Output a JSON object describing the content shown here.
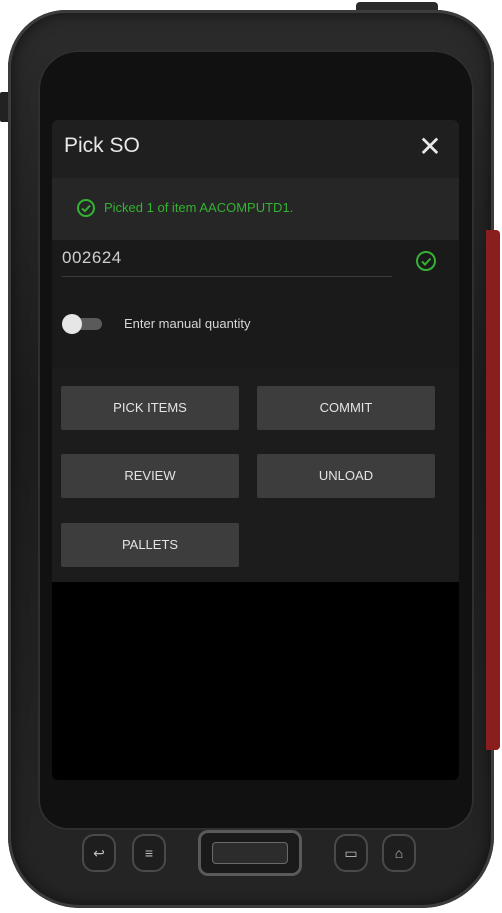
{
  "app": {
    "title": "Pick SO",
    "close_icon": "close-icon"
  },
  "toast": {
    "message": "Picked 1 of item AACOMPUTD1.",
    "icon": "check-circle-icon",
    "color": "#34b233"
  },
  "scan_field": {
    "value": "002624",
    "valid_icon": "check-circle-icon"
  },
  "manual_quantity": {
    "label": "Enter manual quantity",
    "enabled": false
  },
  "actions": {
    "pick_items": "PICK ITEMS",
    "commit": "COMMIT",
    "review": "REVIEW",
    "unload": "UNLOAD",
    "pallets": "PALLETS"
  },
  "hardware_keys": {
    "back": "back-key-icon",
    "menu": "menu-key-icon",
    "recent": "recent-key-icon",
    "home": "home-key-icon"
  }
}
